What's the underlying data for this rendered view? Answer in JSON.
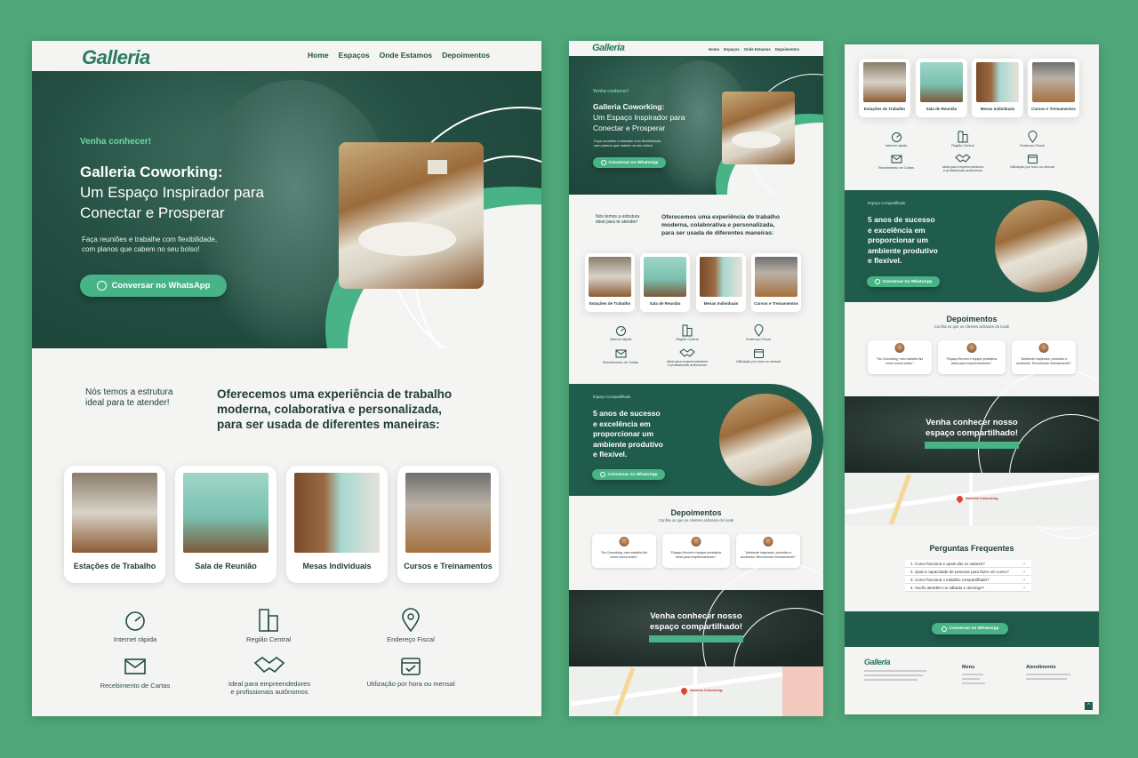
{
  "brand": {
    "logo": "Galleria",
    "colors": {
      "accent": "#48b386",
      "dark": "#1e5a49",
      "background": "#4fa678"
    }
  },
  "nav": [
    "Home",
    "Espaços",
    "Onde Estamos",
    "Depoimentos"
  ],
  "hero": {
    "kicker": "Venha conhecer!",
    "title": "Galleria Coworking:",
    "subtitle_1": "Um Espaço Inspirador para",
    "subtitle_2": "Conectar e Prosperar",
    "desc_1": "Faça reuniões e trabalhe com flexibilidade,",
    "desc_2": "com planos que cabem no seu bolso!",
    "cta": "Conversar no WhatsApp"
  },
  "intro": {
    "left_1": "Nós temos a estrutura",
    "left_2": "ideal para te atender!",
    "right_1": "Oferecemos uma experiência de trabalho",
    "right_2": "moderna, colaborativa e personalizada,",
    "right_3": "para ser usada de diferentes maneiras:"
  },
  "spaces": [
    "Estações de Trabalho",
    "Sala de Reunião",
    "Mesas Individuais",
    "Cursos e Treinamentos"
  ],
  "features": [
    {
      "label": "Internet rápida",
      "icon": "speedometer-icon"
    },
    {
      "label": "Região Central",
      "icon": "buildings-icon"
    },
    {
      "label": "Endereço Fiscal",
      "icon": "map-pin-icon"
    },
    {
      "label": "Recebimento de Cartas",
      "icon": "envelope-icon"
    },
    {
      "label_1": "Ideal para empreendedores",
      "label_2": "e profissionais autônomos",
      "icon": "handshake-icon"
    },
    {
      "label": "Utilização por hora ou mensal",
      "icon": "calendar-icon"
    }
  ],
  "shared": {
    "kicker": "Espaço Compartilhado",
    "title_1": "5 anos de sucesso",
    "title_2": "e excelência em",
    "title_3": "proporcionar um",
    "title_4": "ambiente produtivo",
    "title_5": "e flexível."
  },
  "testimonials": {
    "title": "Depoimentos",
    "subtitle": "Confira os que os clientes acharam do local!",
    "items": [
      {
        "text_1": "\"No Coworking, meu trabalho flui",
        "text_2": "como nunca antes.\""
      },
      {
        "text_1": "\"Espaço flexível e equipe prestativa.",
        "text_2": "Ideal para empreendedores.\""
      },
      {
        "text_1": "\"Ambiente inspirador, produtivo e",
        "text_2": "acolhedor. Recomendo imensamente!\""
      }
    ]
  },
  "visit": {
    "title_1": "Venha conhecer nosso",
    "title_2": "espaço compartilhado!"
  },
  "map": {
    "pin_label": "Galleria Coworking"
  },
  "faq": {
    "title": "Perguntas Frequentes",
    "items": [
      "1. Como funciona e quais são os valores?",
      "2. Qual a capacidade de pessoas para fazer um curso?",
      "3. Como funciona o trabalho compartilhado?",
      "4. Vocês atendem no sábado e domingo?"
    ]
  },
  "footer": {
    "menu_title": "Menu",
    "hours_title": "Atendimento"
  }
}
